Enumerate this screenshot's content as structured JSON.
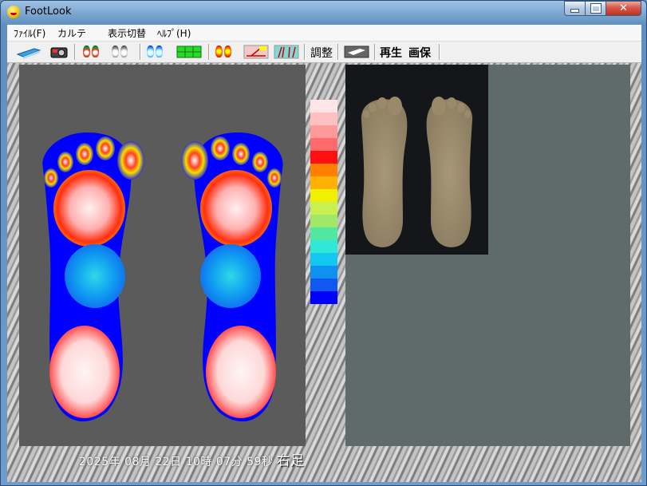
{
  "window": {
    "title": "FootLook"
  },
  "menu": [
    {
      "id": "file",
      "label": "ﾌｧｲﾙ(F)"
    },
    {
      "id": "karte",
      "label": "カルテ"
    },
    {
      "id": "display",
      "label": "表示切替"
    },
    {
      "id": "help",
      "label": "ﾍﾙﾌﾟ(H)"
    }
  ],
  "toolbar": {
    "adjust_label": "調整",
    "play_label": "再生",
    "save_label": "画保"
  },
  "legend_colors": [
    "#ffe6e6",
    "#ffc0c0",
    "#ff9a9a",
    "#ff6a6a",
    "#ff1010",
    "#ff8000",
    "#ffb000",
    "#f0f000",
    "#c8f050",
    "#a0e868",
    "#50e8a0",
    "#30e8d8",
    "#10c8f0",
    "#1090f0",
    "#1058f0",
    "#0000ff"
  ],
  "status": {
    "datetime": "2025年 08月 22日 10時 07分 59秒",
    "foot": "右足"
  }
}
